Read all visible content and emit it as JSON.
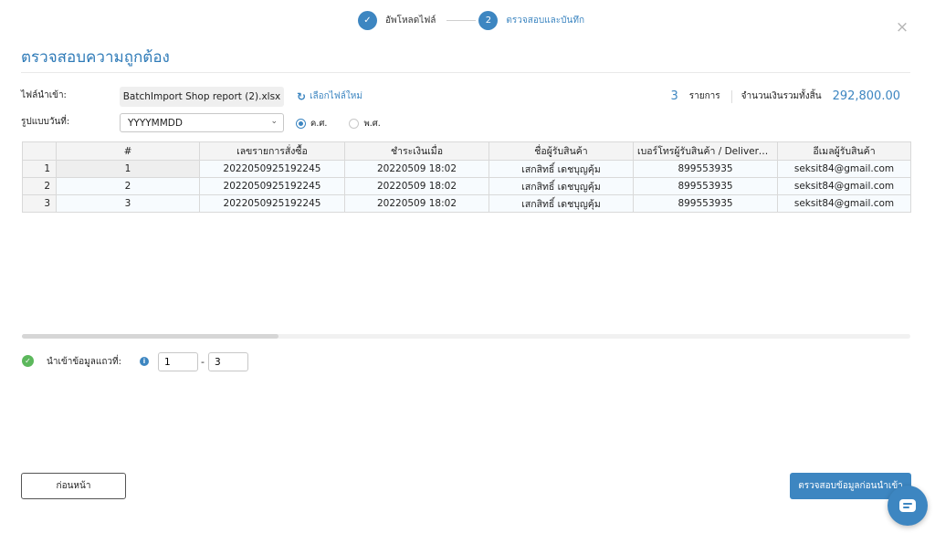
{
  "stepper": {
    "steps": [
      {
        "label": "อัพโหลดไฟล์",
        "badge": "✓"
      },
      {
        "label": "ตรวจสอบและบันทึก",
        "badge": "2"
      }
    ]
  },
  "close": "×",
  "title": "ตรวจสอบความถูกต้อง",
  "form": {
    "file_label": "ไฟล์นำเข้า:",
    "file_name": "BatchImport Shop report (2).xlsx",
    "new_file": "เลือกไฟล์ใหม่",
    "date_label": "รูปแบบวันที่:",
    "date_format": "YYYYMMDD",
    "era_options": [
      "ค.ศ.",
      "พ.ศ."
    ],
    "era_selected": "ค.ศ."
  },
  "summary": {
    "count": "3",
    "count_unit": "รายการ",
    "total_label": "จำนวนเงินรวมทั้งสิ้น",
    "total_value": "292,800.00"
  },
  "table": {
    "headers": [
      "#",
      "เลขรายการสั่งซื้อ",
      "ชำระเงินเมื่อ",
      "ชื่อผู้รับสินค้า",
      "เบอร์โทรผู้รับสินค้า / Delivered...",
      "อีเมลผู้รับสินค้า"
    ],
    "rows": [
      {
        "rownum": "1",
        "cells": [
          "1",
          "2022050925192245",
          "20220509 18:02",
          "เสกสิทธิ์ เดชบุญคุ้ม",
          "899553935",
          "seksit84@gmail.com"
        ]
      },
      {
        "rownum": "2",
        "cells": [
          "2",
          "2022050925192245",
          "20220509 18:02",
          "เสกสิทธิ์ เดชบุญคุ้ม",
          "899553935",
          "seksit84@gmail.com"
        ]
      },
      {
        "rownum": "3",
        "cells": [
          "3",
          "2022050925192245",
          "20220509 18:02",
          "เสกสิทธิ์ เดชบุญคุ้ม",
          "899553935",
          "seksit84@gmail.com"
        ]
      }
    ]
  },
  "import_range": {
    "label": "นำเข้าข้อมูลแถวที่:",
    "from": "1",
    "dash": "-",
    "to": "3"
  },
  "buttons": {
    "back": "ก่อนหน้า",
    "next": "ตรวจสอบข้อมูลก่อนนำเข้า"
  },
  "colors": {
    "accent": "#3d86c1",
    "success": "#5cb85c"
  }
}
